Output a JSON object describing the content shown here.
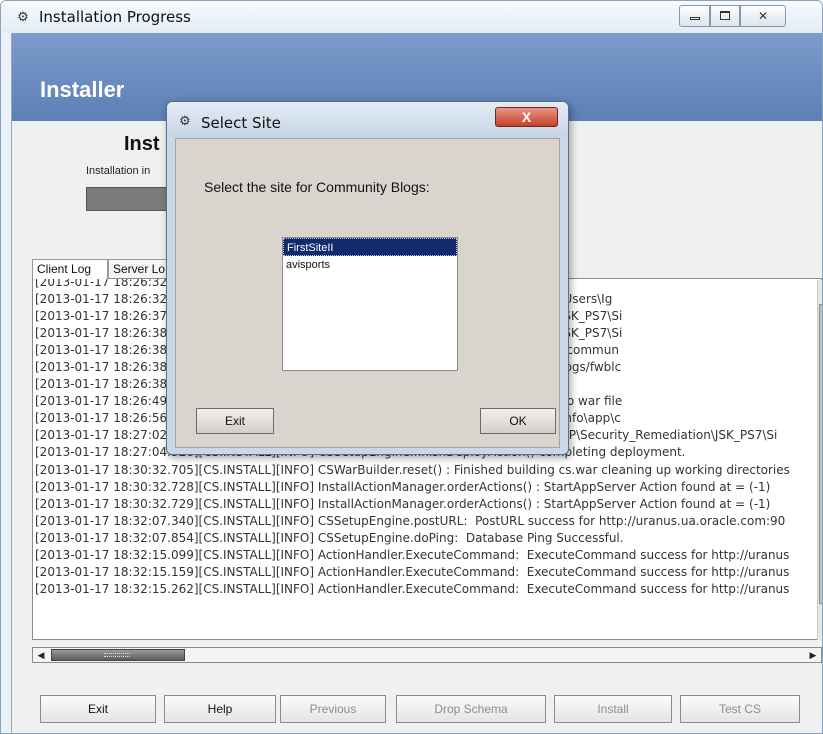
{
  "window": {
    "title": "Installation Progress",
    "icon": "gear-app-icon",
    "controls": {
      "minimize": "minimize-icon",
      "maximize": "maximize-icon",
      "close": "✕"
    }
  },
  "banner": {
    "title": "Installer"
  },
  "install": {
    "heading": "Inst",
    "subtext": "Installation in"
  },
  "tabs": [
    {
      "label": "Client Log"
    },
    {
      "label": "Server Lo"
    }
  ],
  "log": {
    "lines": [
      "[2013-01-17 18:26:32",
      "[2013-01-17 18:26:32                                                          products database found! C:\\Users\\Ig",
      "[2013-01-17 18:26:37                                                          TEMP\\Security_Remediation\\JSK_PS7\\Si",
      "[2013-01-17 18:26:38                                                          TEMP\\Security_Remediation\\JSK_PS7\\Si",
      "[2013-01-17 18:26:38                                                          oying directory D:/_WCS_PS7/commun",
      "[2013-01-17 18:26:38                                                          : D:/_WCS_PS7/community_blogs/fwblc",
      "[2013-01-17 18:26:38                                                          m of prds to install 1",
      "[2013-01-17 18:26:49                                                          nning dump of internal hash to war file",
      "[2013-01-17 18:26:56                                                          S7\\Sites\\11.1.1.8.0\\ominstallinfo\\app\\c",
      "[2013-01-17 18:27:02.892][CS.INSTALL][INFO] ActionHandler.copyFile() Copying D:\\_TEMP\\Security_Remediation\\JSK_PS7\\Si",
      "[2013-01-17 18:27:04.326][CS.INSTALL][INFO] CSSetupEngine.finishDeployAction() completing deployment.",
      "[2013-01-17 18:30:32.705][CS.INSTALL][INFO] CSWarBuilder.reset() : Finished building cs.war cleaning up working directories",
      "[2013-01-17 18:30:32.728][CS.INSTALL][INFO] InstallActionManager.orderActions() : StartAppServer Action found at = (-1)",
      "[2013-01-17 18:30:32.729][CS.INSTALL][INFO] InstallActionManager.orderActions() : StartAppServer Action found at = (-1)",
      "[2013-01-17 18:32:07.340][CS.INSTALL][INFO] CSSetupEngine.postURL:  PostURL success for http://uranus.ua.oracle.com:90",
      "[2013-01-17 18:32:07.854][CS.INSTALL][INFO] CSSetupEngine.doPing:  Database Ping Successful.",
      "[2013-01-17 18:32:15.099][CS.INSTALL][INFO] ActionHandler.ExecuteCommand:  ExecuteCommand success for http://uranus",
      "[2013-01-17 18:32:15.159][CS.INSTALL][INFO] ActionHandler.ExecuteCommand:  ExecuteCommand success for http://uranus",
      "[2013-01-17 18:32:15.262][CS.INSTALL][INFO] ActionHandler.ExecuteCommand:  ExecuteCommand success for http://uranus"
    ]
  },
  "buttons": {
    "exit": "Exit",
    "help": "Help",
    "previous": "Previous",
    "drop_schema": "Drop Schema",
    "install": "Install",
    "test_cs": "Test CS"
  },
  "dialog": {
    "title": "Select Site",
    "close": "X",
    "prompt": "Select the site for Community Blogs:",
    "sites": [
      {
        "label": "FirstSiteII",
        "selected": true
      },
      {
        "label": "avisports",
        "selected": false
      }
    ],
    "exit": "Exit",
    "ok": "OK"
  }
}
